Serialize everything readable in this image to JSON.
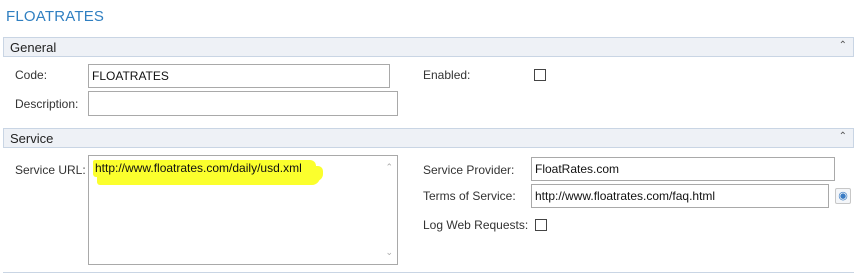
{
  "page": {
    "title": "FLOATRATES"
  },
  "general": {
    "header": "General",
    "collapse_icon": "chevron-up-icon",
    "code_label": "Code:",
    "code_value": "FLOATRATES",
    "enabled_label": "Enabled:",
    "enabled_checked": false,
    "description_label": "Description:",
    "description_value": ""
  },
  "service": {
    "header": "Service",
    "collapse_icon": "chevron-up-icon",
    "service_url_label": "Service URL:",
    "service_url_value": "http://www.floatrates.com/daily/usd.xml",
    "service_provider_label": "Service Provider:",
    "service_provider_value": "FloatRates.com",
    "terms_label": "Terms of Service:",
    "terms_value": "http://www.floatrates.com/faq.html",
    "terms_button_icon": "globe-icon",
    "log_label": "Log Web Requests:",
    "log_checked": false
  },
  "colors": {
    "title": "#2f7fc1",
    "header_bg": "#eef1f6",
    "highlight": "#fbff2d"
  }
}
